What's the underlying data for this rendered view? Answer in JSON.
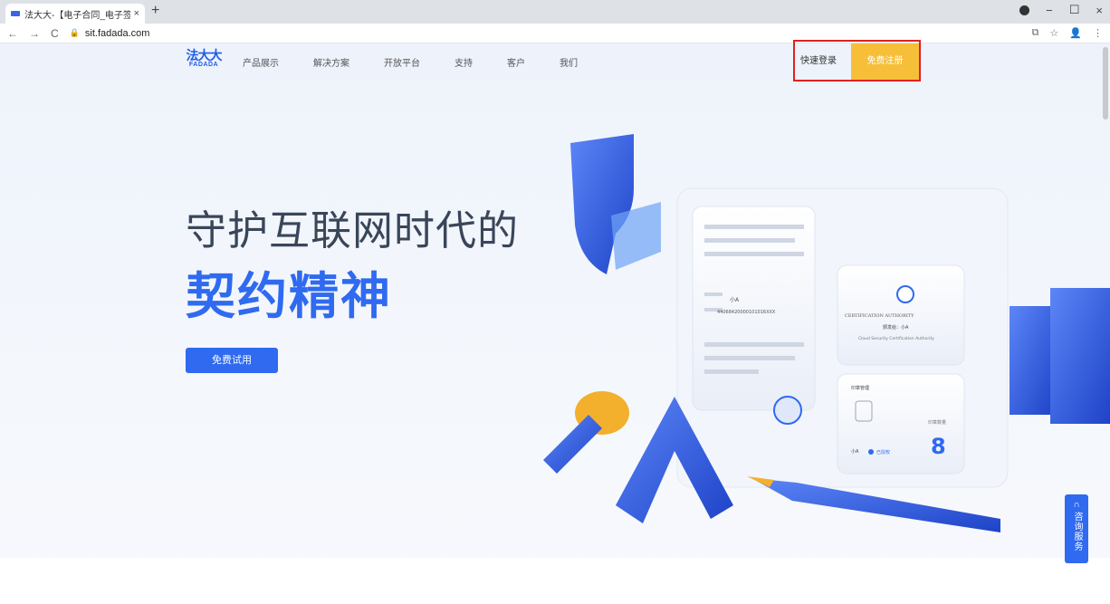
{
  "browser": {
    "tab_title": "法大大-【电子合同_电子签名_电",
    "tab_close": "×",
    "new_tab": "+",
    "url": "sit.fadada.com",
    "nav_back": "←",
    "nav_forward": "→",
    "nav_reload": "C",
    "lock": "🔒",
    "window_min": "−",
    "window_max": "☐",
    "window_close": "×",
    "ext_icon": "⧉",
    "star_icon": "☆",
    "profile_icon": "👤",
    "menu_icon": "⋮"
  },
  "nav": {
    "logo_cn": "法大大",
    "logo_en": "FADADA",
    "items": [
      {
        "label": "产品展示"
      },
      {
        "label": "解决方案"
      },
      {
        "label": "开放平台"
      },
      {
        "label": "支持"
      },
      {
        "label": "客户"
      },
      {
        "label": "我们"
      }
    ],
    "login_label": "快速登录",
    "register_label": "免费注册"
  },
  "hero": {
    "line1": "守护互联网时代的",
    "line2": "契约精神",
    "cta_label": "免费试用"
  },
  "illustration": {
    "card_name": "小A",
    "card_id": "44068420000101016XXX",
    "ca_title": "CERTIFICATION AUTHORITY",
    "ca_issuer": "颁发给：小A",
    "ca_footer": "Cloud Security Certification Authority",
    "seal_title": "印章管理",
    "seal_name": "小A",
    "seal_status": "已授权",
    "seal_count_label": "印章数量",
    "seal_count": "8"
  },
  "consult": {
    "label": "咨询服务"
  },
  "colors": {
    "brand_blue": "#2f6af0",
    "register_yellow": "#f7bf39",
    "highlight_red": "#e02020"
  }
}
